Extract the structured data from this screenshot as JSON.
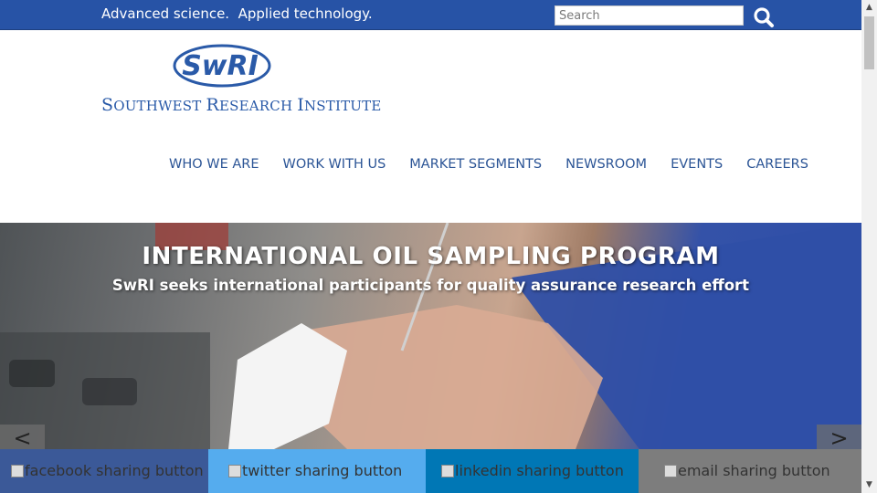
{
  "topbar": {
    "tagline": "Advanced science.  Applied technology.",
    "search_placeholder": "Search",
    "bg_color": "#2753a6"
  },
  "logo": {
    "mark": "SwRI",
    "name_first": "S",
    "name_rest_1": "OUTHWEST ",
    "name_r": "R",
    "name_rest_2": "ESEARCH ",
    "name_i": "I",
    "name_rest_3": "NSTITUTE"
  },
  "nav": {
    "items": [
      "WHO WE ARE",
      "WORK WITH US",
      "MARKET SEGMENTS",
      "NEWSROOM",
      "EVENTS",
      "CAREERS"
    ]
  },
  "hero": {
    "title": "INTERNATIONAL OIL SAMPLING PROGRAM",
    "subtitle": "SwRI seeks international participants for quality assurance research effort",
    "prev_label": "<",
    "next_label": ">"
  },
  "share": {
    "facebook": "facebook sharing button",
    "twitter": "twitter sharing button",
    "linkedin": "linkedin sharing button",
    "email": "email sharing button",
    "colors": {
      "facebook": "#3b5998",
      "twitter": "#55acee",
      "linkedin": "#0077b5",
      "email": "#7d7d7d"
    }
  },
  "icons": {
    "search": "search-icon",
    "scroll_up": "▲",
    "scroll_down": "▼"
  }
}
